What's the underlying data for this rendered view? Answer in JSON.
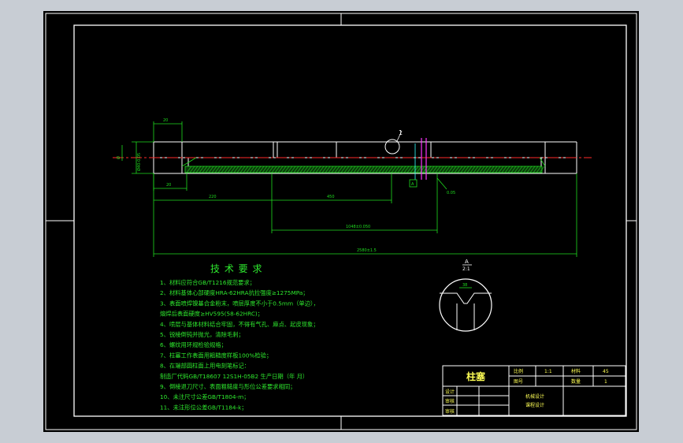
{
  "drawing": {
    "dimensions": {
      "d_top_20": "20",
      "d_bottom_20": "20",
      "d_left_dia": "Ø40-0.05",
      "d_small_dia": "Ø",
      "d_220": "220",
      "d_450": "450",
      "d_mid": "1048±0.050",
      "d_total": "2580±1.5",
      "tol_box": "A",
      "right_note": "0.05",
      "callout_num": "1"
    },
    "section_label_a": "A",
    "section_label_b": "2:1",
    "detail_dim": "38",
    "requirements": {
      "title": "技 术 要 求",
      "items": [
        "1、材料应符合GB/T1216规范要求；",
        "2、材料基体心部硬度HRA-62HRA抗拉强度≥1275MPa；",
        "3、表面喷焊镍基合金粉末，喷层厚度不小于0.5mm（单边），",
        "   熔焊后表面硬度≥HV595(58-62HRC)；",
        "4、喷层与基体材料结合牢固，不得有气孔、麻点、起皮现象；",
        "5、锐棱倒钝并抛光，清除毛刺；",
        "6、螺纹用环规检验规格；",
        "7、柱塞工作表面用粗糙度样板100%检验；",
        "8、在端部圆柱面上用电刻笔标记：",
        "   制造厂代码GB/T18607 12S1H-05B2 生产日期（年 月）",
        "9、倒棱退刀尺寸、表面粗糙度与形位公差要求相同；",
        "10、未注尺寸公差GB/T1804-m；",
        "11、未注形位公差GB/T1184-k；"
      ]
    },
    "title_block": {
      "part_name": "柱塞",
      "scale_label": "比例",
      "scale_value": "1:1",
      "material_label": "材料",
      "material_value": "45",
      "drawing_no_label": "图号",
      "qty_label": "数量",
      "qty_value": "1",
      "design_label": "设计",
      "check_label": "审核",
      "review_label": "审核",
      "dept_line1": "机械设计",
      "dept_line2": "课程设计"
    },
    "colors": {
      "frame": "#ffffff",
      "dimension": "#1fdc1f",
      "centerline": "#ff2a2a",
      "hatch": "#1fdc1f",
      "note_text": "#2ee82e",
      "title_text": "#ffff55",
      "magenta": "#ff33ff",
      "cyan": "#33ffff"
    }
  }
}
